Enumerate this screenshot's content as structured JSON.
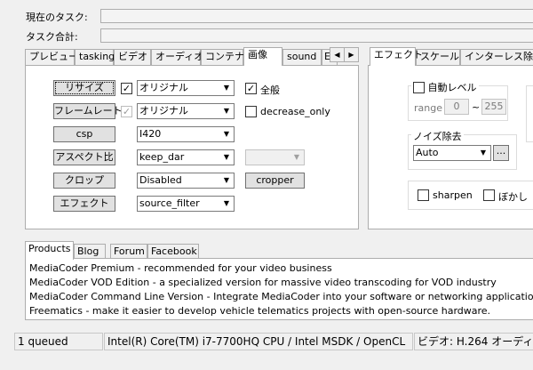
{
  "task": {
    "current_label": "現在のタスク:",
    "total_label": "タスク合計:"
  },
  "tabs": [
    {
      "label": "プレビュー"
    },
    {
      "label": "tasking"
    },
    {
      "label": "ビデオ"
    },
    {
      "label": "オーディオ"
    },
    {
      "label": "コンテナ"
    },
    {
      "label": "画像",
      "active": true
    },
    {
      "label": "sound"
    },
    {
      "label": "E"
    }
  ],
  "right_tabs": [
    {
      "label": "エフェクト",
      "active": true
    },
    {
      "label": "スケール"
    },
    {
      "label": "インターレス除去"
    }
  ],
  "image_panel": {
    "resize": {
      "button": "リサイズ",
      "value": "オリジナル",
      "checked": true
    },
    "framerate": {
      "button": "フレームレート",
      "value": "オリジナル",
      "checked": true
    },
    "csp": {
      "button": "csp",
      "value": "I420"
    },
    "aspect": {
      "button": "アスペクト比",
      "value": "keep_dar"
    },
    "crop": {
      "button": "クロップ",
      "value": "Disabled",
      "side_button": "cropper"
    },
    "effect": {
      "button": "エフェクト",
      "value": "source_filter"
    },
    "all": {
      "label": "全般",
      "checked": true
    },
    "decrease_only": {
      "label": "decrease_only",
      "checked": false
    }
  },
  "effects_panel": {
    "auto_level": {
      "label": "自動レベル",
      "checked": false
    },
    "range_label": "range",
    "range_from": "0",
    "range_sep": "~",
    "range_to": "255",
    "denoise_label": "ノイズ除去",
    "denoise_value": "Auto",
    "denoise_more": "...",
    "sharpen": {
      "label": "sharpen",
      "checked": false
    },
    "blur": {
      "label": "ぼかし",
      "checked": false
    }
  },
  "bottom_tabs": [
    {
      "label": "Products",
      "active": true
    },
    {
      "label": "Blog"
    },
    {
      "label": "Forum"
    },
    {
      "label": "Facebook"
    }
  ],
  "products": [
    "MediaCoder Premium - recommended for your video business",
    "MediaCoder VOD Edition - a specialized version for massive video transcoding for VOD industry",
    "MediaCoder Command Line Version - Integrate MediaCoder into your software or networking application",
    "Freematics - make it easier to develop vehicle telematics projects with open-source hardware."
  ],
  "status": {
    "queued": "1 queued",
    "cpu": "Intel(R) Core(TM) i7-7700HQ CPU  / Intel MSDK / OpenCL",
    "codec": "ビデオ: H.264  オーディ"
  }
}
